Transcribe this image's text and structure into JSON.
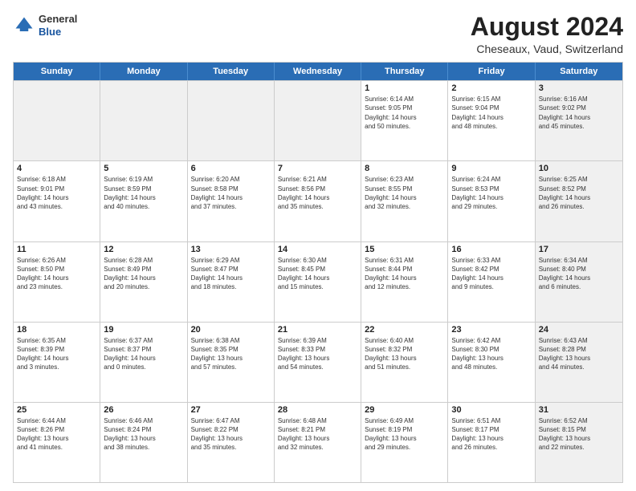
{
  "header": {
    "logo": {
      "general": "General",
      "blue": "Blue"
    },
    "title": "August 2024",
    "location": "Cheseaux, Vaud, Switzerland"
  },
  "days_of_week": [
    "Sunday",
    "Monday",
    "Tuesday",
    "Wednesday",
    "Thursday",
    "Friday",
    "Saturday"
  ],
  "weeks": [
    [
      {
        "day": "",
        "info": "",
        "shaded": true
      },
      {
        "day": "",
        "info": "",
        "shaded": true
      },
      {
        "day": "",
        "info": "",
        "shaded": true
      },
      {
        "day": "",
        "info": "",
        "shaded": true
      },
      {
        "day": "1",
        "info": "Sunrise: 6:14 AM\nSunset: 9:05 PM\nDaylight: 14 hours\nand 50 minutes.",
        "shaded": false
      },
      {
        "day": "2",
        "info": "Sunrise: 6:15 AM\nSunset: 9:04 PM\nDaylight: 14 hours\nand 48 minutes.",
        "shaded": false
      },
      {
        "day": "3",
        "info": "Sunrise: 6:16 AM\nSunset: 9:02 PM\nDaylight: 14 hours\nand 45 minutes.",
        "shaded": true
      }
    ],
    [
      {
        "day": "4",
        "info": "Sunrise: 6:18 AM\nSunset: 9:01 PM\nDaylight: 14 hours\nand 43 minutes.",
        "shaded": false
      },
      {
        "day": "5",
        "info": "Sunrise: 6:19 AM\nSunset: 8:59 PM\nDaylight: 14 hours\nand 40 minutes.",
        "shaded": false
      },
      {
        "day": "6",
        "info": "Sunrise: 6:20 AM\nSunset: 8:58 PM\nDaylight: 14 hours\nand 37 minutes.",
        "shaded": false
      },
      {
        "day": "7",
        "info": "Sunrise: 6:21 AM\nSunset: 8:56 PM\nDaylight: 14 hours\nand 35 minutes.",
        "shaded": false
      },
      {
        "day": "8",
        "info": "Sunrise: 6:23 AM\nSunset: 8:55 PM\nDaylight: 14 hours\nand 32 minutes.",
        "shaded": false
      },
      {
        "day": "9",
        "info": "Sunrise: 6:24 AM\nSunset: 8:53 PM\nDaylight: 14 hours\nand 29 minutes.",
        "shaded": false
      },
      {
        "day": "10",
        "info": "Sunrise: 6:25 AM\nSunset: 8:52 PM\nDaylight: 14 hours\nand 26 minutes.",
        "shaded": true
      }
    ],
    [
      {
        "day": "11",
        "info": "Sunrise: 6:26 AM\nSunset: 8:50 PM\nDaylight: 14 hours\nand 23 minutes.",
        "shaded": false
      },
      {
        "day": "12",
        "info": "Sunrise: 6:28 AM\nSunset: 8:49 PM\nDaylight: 14 hours\nand 20 minutes.",
        "shaded": false
      },
      {
        "day": "13",
        "info": "Sunrise: 6:29 AM\nSunset: 8:47 PM\nDaylight: 14 hours\nand 18 minutes.",
        "shaded": false
      },
      {
        "day": "14",
        "info": "Sunrise: 6:30 AM\nSunset: 8:45 PM\nDaylight: 14 hours\nand 15 minutes.",
        "shaded": false
      },
      {
        "day": "15",
        "info": "Sunrise: 6:31 AM\nSunset: 8:44 PM\nDaylight: 14 hours\nand 12 minutes.",
        "shaded": false
      },
      {
        "day": "16",
        "info": "Sunrise: 6:33 AM\nSunset: 8:42 PM\nDaylight: 14 hours\nand 9 minutes.",
        "shaded": false
      },
      {
        "day": "17",
        "info": "Sunrise: 6:34 AM\nSunset: 8:40 PM\nDaylight: 14 hours\nand 6 minutes.",
        "shaded": true
      }
    ],
    [
      {
        "day": "18",
        "info": "Sunrise: 6:35 AM\nSunset: 8:39 PM\nDaylight: 14 hours\nand 3 minutes.",
        "shaded": false
      },
      {
        "day": "19",
        "info": "Sunrise: 6:37 AM\nSunset: 8:37 PM\nDaylight: 14 hours\nand 0 minutes.",
        "shaded": false
      },
      {
        "day": "20",
        "info": "Sunrise: 6:38 AM\nSunset: 8:35 PM\nDaylight: 13 hours\nand 57 minutes.",
        "shaded": false
      },
      {
        "day": "21",
        "info": "Sunrise: 6:39 AM\nSunset: 8:33 PM\nDaylight: 13 hours\nand 54 minutes.",
        "shaded": false
      },
      {
        "day": "22",
        "info": "Sunrise: 6:40 AM\nSunset: 8:32 PM\nDaylight: 13 hours\nand 51 minutes.",
        "shaded": false
      },
      {
        "day": "23",
        "info": "Sunrise: 6:42 AM\nSunset: 8:30 PM\nDaylight: 13 hours\nand 48 minutes.",
        "shaded": false
      },
      {
        "day": "24",
        "info": "Sunrise: 6:43 AM\nSunset: 8:28 PM\nDaylight: 13 hours\nand 44 minutes.",
        "shaded": true
      }
    ],
    [
      {
        "day": "25",
        "info": "Sunrise: 6:44 AM\nSunset: 8:26 PM\nDaylight: 13 hours\nand 41 minutes.",
        "shaded": false
      },
      {
        "day": "26",
        "info": "Sunrise: 6:46 AM\nSunset: 8:24 PM\nDaylight: 13 hours\nand 38 minutes.",
        "shaded": false
      },
      {
        "day": "27",
        "info": "Sunrise: 6:47 AM\nSunset: 8:22 PM\nDaylight: 13 hours\nand 35 minutes.",
        "shaded": false
      },
      {
        "day": "28",
        "info": "Sunrise: 6:48 AM\nSunset: 8:21 PM\nDaylight: 13 hours\nand 32 minutes.",
        "shaded": false
      },
      {
        "day": "29",
        "info": "Sunrise: 6:49 AM\nSunset: 8:19 PM\nDaylight: 13 hours\nand 29 minutes.",
        "shaded": false
      },
      {
        "day": "30",
        "info": "Sunrise: 6:51 AM\nSunset: 8:17 PM\nDaylight: 13 hours\nand 26 minutes.",
        "shaded": false
      },
      {
        "day": "31",
        "info": "Sunrise: 6:52 AM\nSunset: 8:15 PM\nDaylight: 13 hours\nand 22 minutes.",
        "shaded": true
      }
    ]
  ]
}
